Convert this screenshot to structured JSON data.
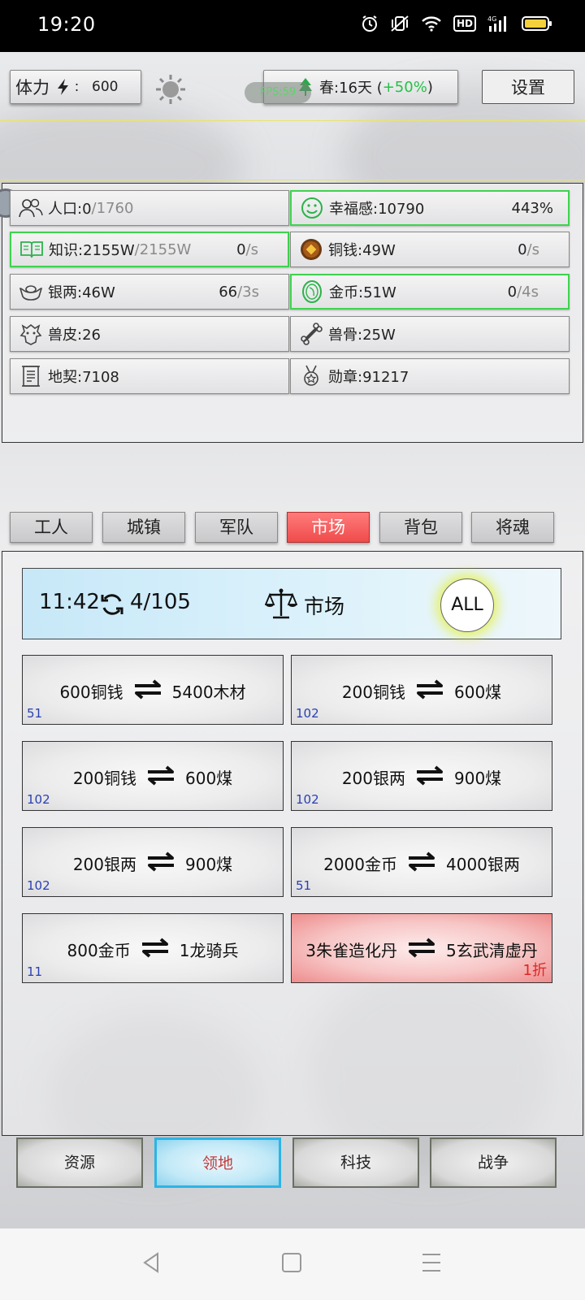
{
  "status_bar": {
    "time": "19:20",
    "network": "4G",
    "hd": "HD"
  },
  "top_bar": {
    "stamina_label": "体力",
    "stamina_sep": "：",
    "stamina_value": "600",
    "season_label": "春:16天 (",
    "season_bonus": "+50%",
    "season_close": ")",
    "fps_label": "FPS:59",
    "settings_label": "设置"
  },
  "resources": [
    {
      "icon": "people-icon",
      "name": "人口:0",
      "extra": "/1760"
    },
    {
      "icon": "smile-icon",
      "name": "幸福感:10790",
      "pct": "443%"
    },
    {
      "icon": "book-icon",
      "name": "知识:2155W",
      "extra": "/2155W",
      "rate_val": "0",
      "rate_unit": "/s"
    },
    {
      "icon": "copper-coin-icon",
      "name": "铜钱:49W",
      "rate_val": "0",
      "rate_unit": "/s"
    },
    {
      "icon": "silver-ingot-icon",
      "name": "银两:46W",
      "rate_val": "66",
      "rate_unit": "/3s"
    },
    {
      "icon": "gold-coin-icon",
      "name": "金币:51W",
      "rate_val": "0",
      "rate_unit": "/4s"
    },
    {
      "icon": "beast-hide-icon",
      "name": "兽皮:26"
    },
    {
      "icon": "bone-icon",
      "name": "兽骨:25W"
    },
    {
      "icon": "deed-icon",
      "name": "地契:7108"
    },
    {
      "icon": "medal-icon",
      "name": "勋章:91217"
    }
  ],
  "tabs": [
    "工人",
    "城镇",
    "军队",
    "市场",
    "背包",
    "将魂"
  ],
  "market": {
    "timer": "11:42",
    "count": "4/105",
    "title": "市场",
    "all_label": "ALL",
    "trades": [
      {
        "give": "600铜钱",
        "get": "5400木材",
        "stock": "51"
      },
      {
        "give": "200铜钱",
        "get": "600煤",
        "stock": "102"
      },
      {
        "give": "200铜钱",
        "get": "600煤",
        "stock": "102"
      },
      {
        "give": "200银两",
        "get": "900煤",
        "stock": "102"
      },
      {
        "give": "200银两",
        "get": "900煤",
        "stock": "102"
      },
      {
        "give": "2000金币",
        "get": "4000银两",
        "stock": "51"
      },
      {
        "give": "800金币",
        "get": "1龙骑兵",
        "stock": "11"
      },
      {
        "give": "3朱雀造化丹",
        "get": "5玄武清虚丹",
        "discount": "1折"
      }
    ]
  },
  "bottom_nav": [
    "资源",
    "领地",
    "科技",
    "战争"
  ],
  "colors": {
    "accent_green": "#26c146",
    "active_tab": "#f04b4b",
    "active_nav": "#2cb4e5",
    "stock_blue": "#2a3fb0",
    "discount_red": "#e02525"
  }
}
